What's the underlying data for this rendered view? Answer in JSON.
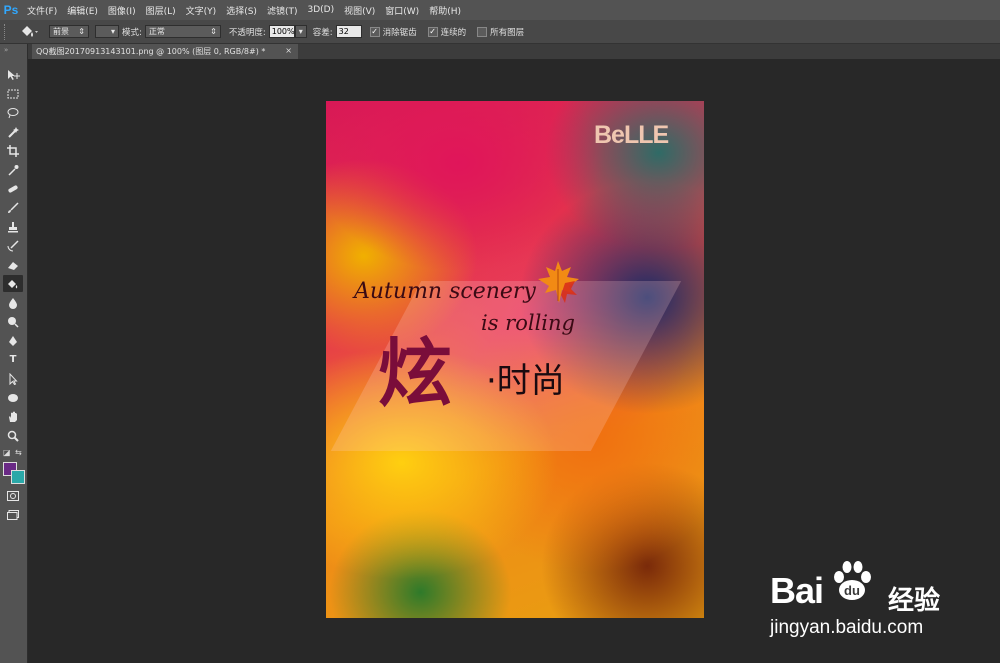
{
  "app": {
    "logo": "Ps"
  },
  "menu": [
    "文件(F)",
    "编辑(E)",
    "图像(I)",
    "图层(L)",
    "文字(Y)",
    "选择(S)",
    "滤镜(T)",
    "3D(D)",
    "视图(V)",
    "窗口(W)",
    "帮助(H)"
  ],
  "options": {
    "fill_source": "前景",
    "mode_label": "模式:",
    "mode_value": "正常",
    "opacity_label": "不透明度:",
    "opacity_value": "100%",
    "tolerance_label": "容差:",
    "tolerance_value": "32",
    "antialias_label": "消除锯齿",
    "contiguous_label": "连续的",
    "all_layers_label": "所有图层"
  },
  "document": {
    "tab_title": "QQ截图20170913143101.png @ 100% (图层 0, RGB/8#) *"
  },
  "poster": {
    "brand": "BeLLE",
    "script_line1": "Autumn scenery",
    "script_line2": "is rolling",
    "big_char": "炫",
    "sub_text": "·时尚"
  },
  "watermark": {
    "brand": "Bai",
    "brand_cn": "经验",
    "url": "jingyan.baidu.com"
  },
  "colors": {
    "foreground": "#6a2a86",
    "background": "#2aa8a8"
  }
}
